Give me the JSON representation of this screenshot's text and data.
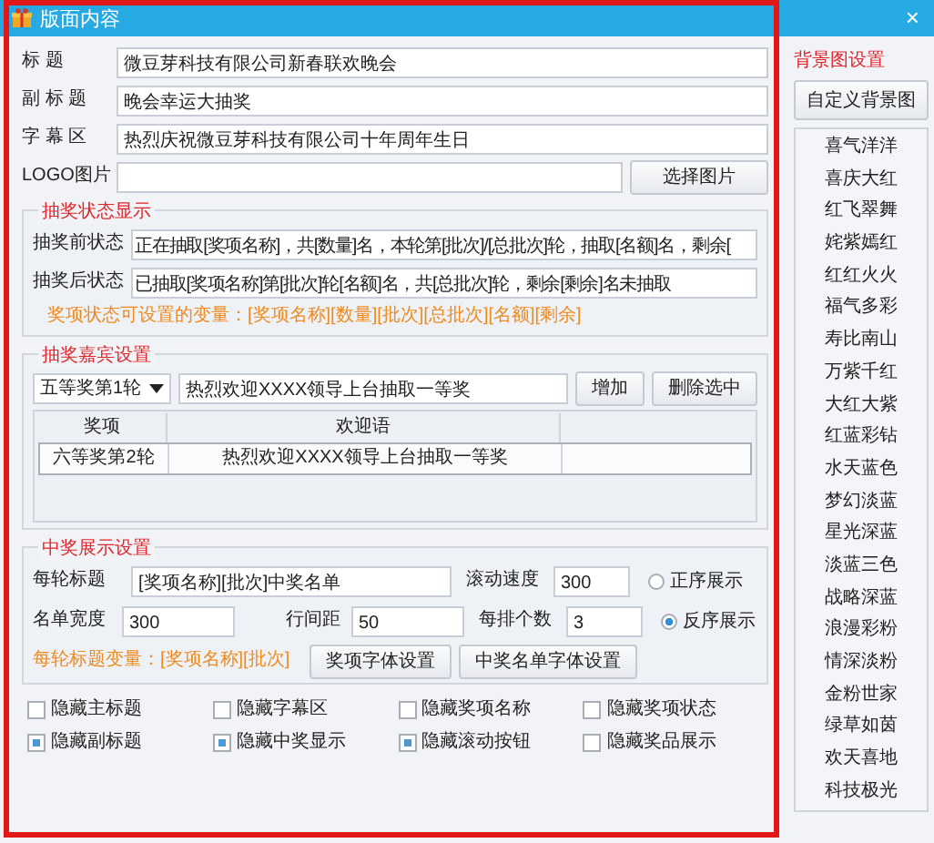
{
  "window": {
    "title": "版面内容",
    "close": "×"
  },
  "header_fields": [
    {
      "label": "标 题",
      "value": "微豆芽科技有限公司新春联欢晚会"
    },
    {
      "label": "副 标 题",
      "value": "晚会幸运大抽奖"
    },
    {
      "label": "字 幕 区",
      "value": "热烈庆祝微豆芽科技有限公司十年周年生日"
    },
    {
      "label": "LOGO图片",
      "button": "选择图片"
    }
  ],
  "status_group": {
    "title": "抽奖状态显示",
    "fields": [
      {
        "label": "抽奖前状态",
        "value": "正在抽取[奖项名称]，共[数量]名，本轮第[批次]/[总批次]轮，抽取[名额]名，剩余["
      },
      {
        "label": "抽奖后状态",
        "value": "已抽取[奖项名称]第[批次]轮[名额]名，共[总批次]轮，剩余[剩余]名未抽取"
      }
    ],
    "note": "奖项状态可设置的变量：[奖项名称][数量][批次][总批次][名额][剩余]"
  },
  "guest_group": {
    "title": "抽奖嘉宾设置",
    "prize_select": "五等奖第1轮",
    "welcome_input": "热烈欢迎XXXX领导上台抽取一等奖",
    "buttons": [
      "增加",
      "删除选中"
    ],
    "table": {
      "columns": [
        "奖项",
        "欢迎语"
      ],
      "rows": [
        [
          "六等奖第2轮",
          "热烈欢迎XXXX领导上台抽取一等奖"
        ]
      ]
    }
  },
  "winner_group": {
    "title": "中奖展示设置",
    "round_title": {
      "label": "每轮标题",
      "value": "[奖项名称][批次]中奖名单"
    },
    "scroll_speed": {
      "label": "滚动速度",
      "value": "300"
    },
    "list_width": {
      "label": "名单宽度",
      "value": "300"
    },
    "line_spacing": {
      "label": "行间距",
      "value": "50"
    },
    "per_row": {
      "label": "每排个数",
      "value": "3"
    },
    "order": [
      {
        "label": "正序展示",
        "selected": false
      },
      {
        "label": "反序展示",
        "selected": true
      }
    ],
    "note": "每轮标题变量：[奖项名称][批次]",
    "buttons": [
      "奖项字体设置",
      "中奖名单字体设置"
    ]
  },
  "hide_options": [
    {
      "label": "隐藏主标题",
      "checked": false
    },
    {
      "label": "隐藏字幕区",
      "checked": false
    },
    {
      "label": "隐藏奖项名称",
      "checked": false
    },
    {
      "label": "隐藏奖项状态",
      "checked": false
    },
    {
      "label": "隐藏副标题",
      "checked": true
    },
    {
      "label": "隐藏中奖显示",
      "checked": true
    },
    {
      "label": "隐藏滚动按钮",
      "checked": true
    },
    {
      "label": "隐藏奖品展示",
      "checked": false
    }
  ],
  "background": {
    "title": "背景图设置",
    "button": "自定义背景图",
    "themes": [
      "喜气洋洋",
      "喜庆大红",
      "红飞翠舞",
      "姹紫嫣红",
      "红红火火",
      "福气多彩",
      "寿比南山",
      "万紫千红",
      "大红大紫",
      "红蓝彩钻",
      "水天蓝色",
      "梦幻淡蓝",
      "星光深蓝",
      "淡蓝三色",
      "战略深蓝",
      "浪漫彩粉",
      "情深淡粉",
      "金粉世家",
      "绿草如茵",
      "欢天喜地",
      "科技极光"
    ]
  }
}
